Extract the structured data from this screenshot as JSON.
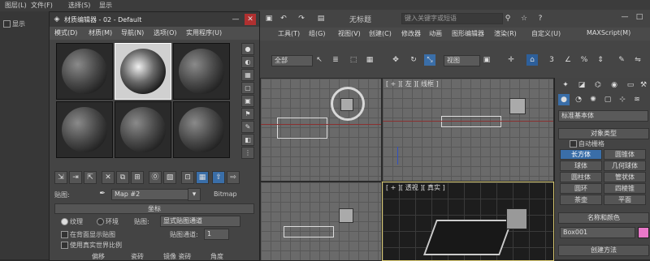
{
  "top_menu": {
    "items": [
      "图层(L)",
      "文件(F)",
      "选择(S)",
      "显示"
    ],
    "display_label": "显示"
  },
  "app": {
    "title": "无标题",
    "search_placeholder": "键入关键字或短语",
    "menu": [
      "工具(T)",
      "组(G)",
      "视图(V)",
      "创建(C)",
      "修改器",
      "动画",
      "图形编辑器",
      "渲染(R)",
      "自定义(U)",
      "MAXScript(M)"
    ],
    "selection_filter": "全部",
    "view_dropdown": "视图",
    "snap_number": "3",
    "snap_percent": "%"
  },
  "viewports": {
    "top_left_label": "",
    "top_right_label": "[ + ][ 左 ][ 线框 ]",
    "persp_label": "[ + ][ 透视 ][ 真实 ]"
  },
  "material_editor": {
    "title": "材质编辑器 - 02 - Default",
    "menu": [
      "模式(D)",
      "材质(M)",
      "导航(N)",
      "选项(O)",
      "实用程序(U)"
    ],
    "map_label": "贴图:",
    "map_name": "Map #2",
    "map_type": "Bitmap",
    "coords_title": "坐标",
    "texture_label": "纹理",
    "environ_label": "环境",
    "mapping_label": "贴图:",
    "mapping_value": "显式贴图通道",
    "show_map_back": "在背面显示贴图",
    "map_channel_label": "贴图通道:",
    "map_channel_value": "1",
    "real_world": "使用真实世界比例",
    "offset_header": "偏移",
    "tiling_header": "瓷砖",
    "mirror_header": "镜像 瓷砖",
    "angle_header": "角度"
  },
  "command_panel": {
    "category": "标准基本体",
    "object_type_title": "对象类型",
    "autogrid": "自动栅格",
    "buttons": [
      [
        "长方体",
        "圆锥体"
      ],
      [
        "球体",
        "几何球体"
      ],
      [
        "圆柱体",
        "管状体"
      ],
      [
        "圆环",
        "四棱锥"
      ],
      [
        "茶壶",
        "平面"
      ]
    ],
    "name_color_title": "名称和颜色",
    "object_name": "Box001",
    "creation_method_title": "创建方法",
    "accent_color": "#3a6ea8",
    "swatch_color": "#e878c8"
  }
}
